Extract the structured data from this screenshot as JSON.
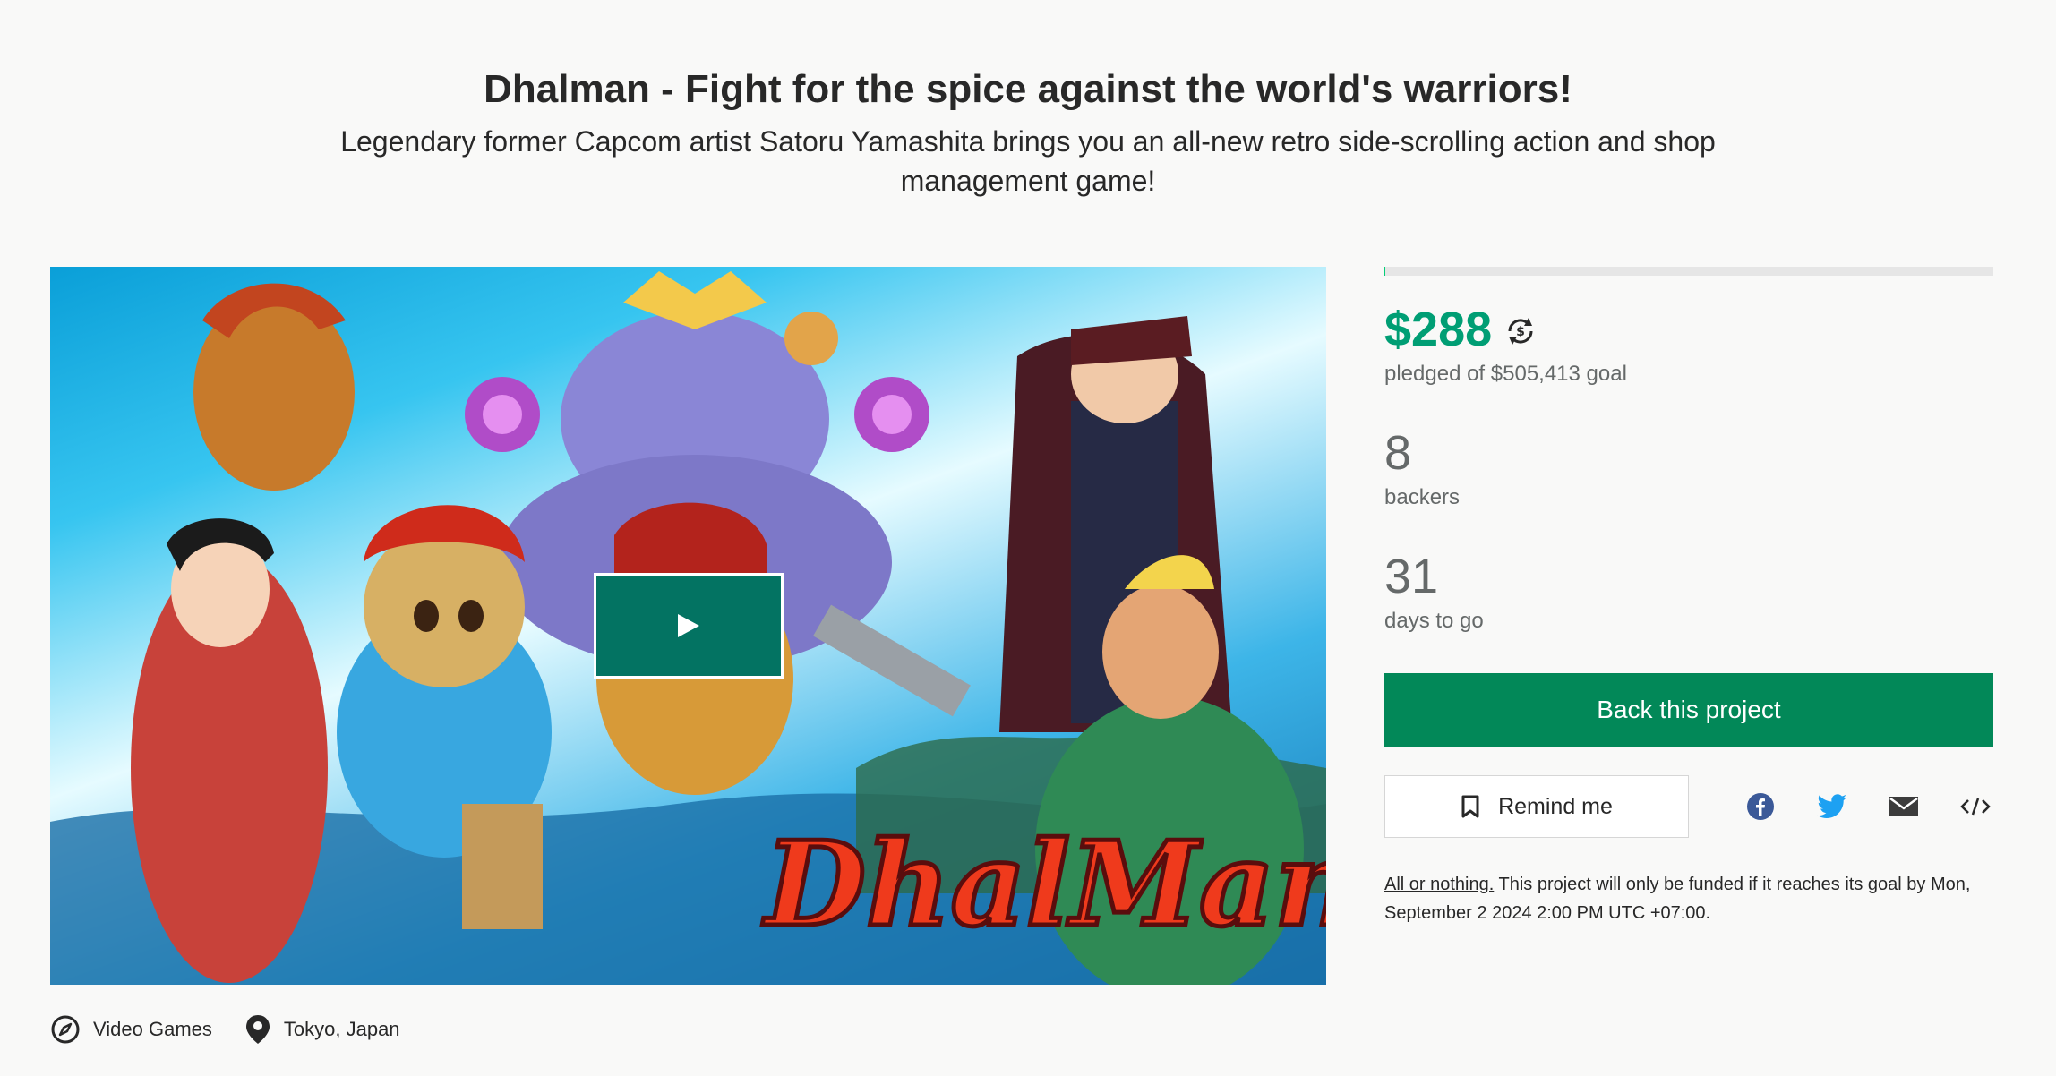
{
  "project": {
    "title": "Dhalman - Fight for the spice against the world's warriors!",
    "blurb": "Legendary former Capcom artist Satoru Yamashita brings you an all-new retro side-scrolling action and shop management game!",
    "media": {
      "logo_text": "DhalMan",
      "play_icon": "play-icon"
    },
    "tags": [
      {
        "icon": "compass-icon",
        "label": "Video Games"
      },
      {
        "icon": "location-pin-icon",
        "label": "Tokyo, Japan"
      }
    ]
  },
  "stats": {
    "progress_fraction": 0.00057,
    "amount": "$288",
    "currency_icon": "currency-conversion-icon",
    "pledged_label": "pledged of $505,413 goal",
    "backers": "8",
    "backers_label": "backers",
    "days": "31",
    "days_label": "days to go"
  },
  "actions": {
    "back_label": "Back this project",
    "remind_label": "Remind me",
    "remind_icon": "bookmark-icon",
    "share": [
      "facebook-icon",
      "twitter-icon",
      "email-icon",
      "embed-code-icon"
    ]
  },
  "fine_print": {
    "link": "All or nothing.",
    "text": " This project will only be funded if it reaches its goal by Mon, September 2 2024 2:00 PM UTC +07:00."
  },
  "colors": {
    "accent_green": "#009e74",
    "button_green": "#028858",
    "play_button": "#037362"
  }
}
